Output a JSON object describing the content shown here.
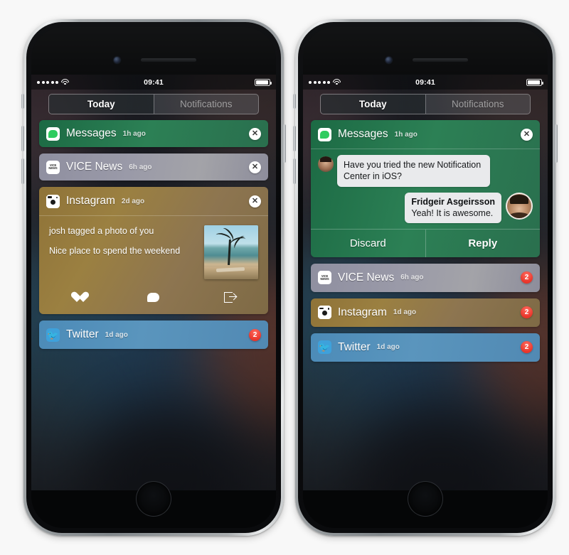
{
  "status_bar": {
    "signal_dots": 5,
    "wifi": "wifi-icon",
    "time": "09:41",
    "battery": "battery-icon"
  },
  "segmented_control": {
    "today_label": "Today",
    "notifications_label": "Notifications",
    "active": "Today"
  },
  "colors": {
    "messages_green": "#2c8055",
    "vice_grey": "#9a9aa8",
    "instagram_gold": "#8f7338",
    "twitter_blue": "#5a95bd",
    "badge_red": "#e8352a"
  },
  "left_phone": {
    "notifications": [
      {
        "app": "Messages",
        "icon": "messages-icon",
        "time": "1h ago",
        "action": "close",
        "action_label": "✕"
      },
      {
        "app": "VICE News",
        "icon": "vice-news-icon",
        "icon_text_top": "VICE",
        "icon_text_bottom": "NEWS",
        "time": "6h ago",
        "action": "close",
        "action_label": "✕"
      },
      {
        "app": "Instagram",
        "icon": "instagram-icon",
        "time": "2d ago",
        "action": "close",
        "action_label": "✕",
        "expanded": true,
        "body_line_1": "josh tagged a photo of you",
        "body_line_2": "Nice place to spend the weekend",
        "photo": "beach-palm-tree-photo",
        "actions": [
          {
            "name": "like",
            "icon": "heart-icon"
          },
          {
            "name": "comment",
            "icon": "speech-bubble-icon"
          },
          {
            "name": "share",
            "icon": "share-icon"
          }
        ]
      },
      {
        "app": "Twitter",
        "icon": "twitter-icon",
        "time": "1d ago",
        "action": "badge",
        "badge": "2"
      }
    ]
  },
  "right_phone": {
    "notifications": [
      {
        "app": "Messages",
        "icon": "messages-icon",
        "time": "1h ago",
        "action": "close",
        "action_label": "✕",
        "expanded": true,
        "thread": [
          {
            "direction": "incoming",
            "avatar": "contact-avatar-small",
            "text": "Have you tried the new Notification Center in iOS?"
          },
          {
            "direction": "outgoing",
            "sender": "Fridgeir Asgeirsson",
            "text": "Yeah! It is awesome.",
            "avatar": "contact-avatar-large"
          }
        ],
        "buttons": {
          "discard_label": "Discard",
          "reply_label": "Reply"
        }
      },
      {
        "app": "VICE News",
        "icon": "vice-news-icon",
        "icon_text_top": "VICE",
        "icon_text_bottom": "NEWS",
        "time": "6h ago",
        "action": "badge",
        "badge": "2"
      },
      {
        "app": "Instagram",
        "icon": "instagram-icon",
        "time": "1d ago",
        "action": "badge",
        "badge": "2"
      },
      {
        "app": "Twitter",
        "icon": "twitter-icon",
        "time": "1d ago",
        "action": "badge",
        "badge": "2"
      }
    ]
  },
  "grabber": "notification-center-grabber-handle"
}
